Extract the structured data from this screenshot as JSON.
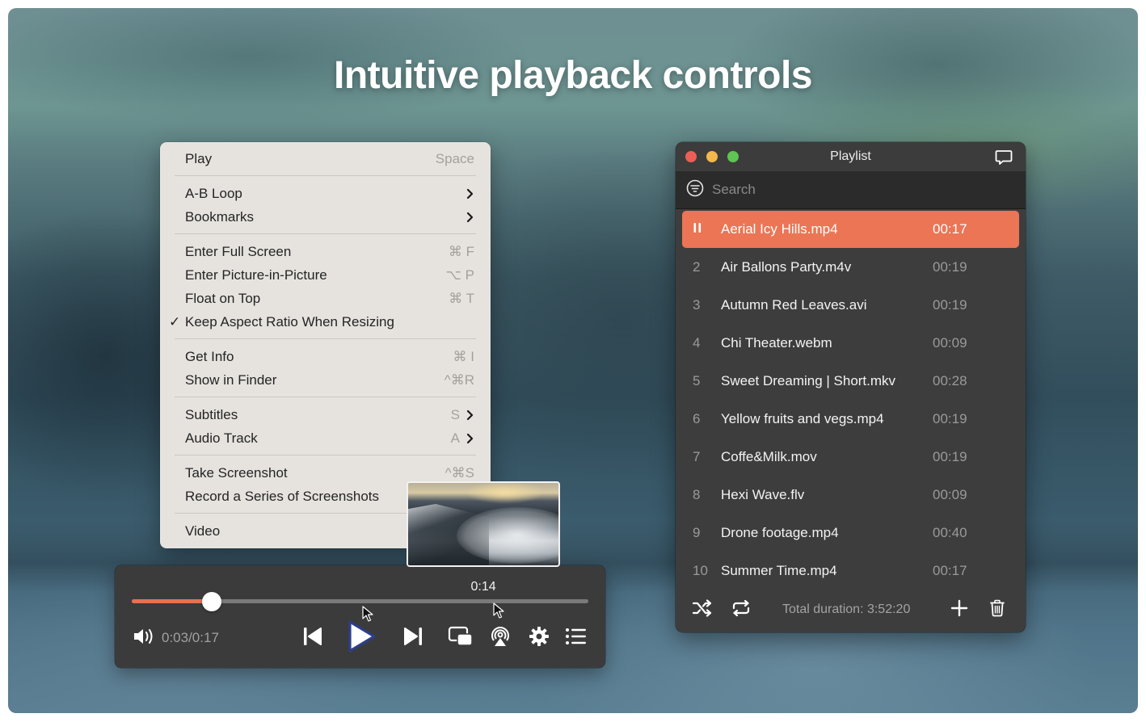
{
  "headline": "Intuitive playback controls",
  "context_menu": {
    "items": [
      {
        "label": "Play",
        "shortcut": "Space"
      },
      {
        "label": "A-B Loop",
        "submenu": true
      },
      {
        "label": "Bookmarks",
        "submenu": true
      },
      {
        "label": "Enter Full Screen",
        "shortcut": "⌘ F"
      },
      {
        "label": "Enter Picture-in-Picture",
        "shortcut": "⌥ P"
      },
      {
        "label": "Float on Top",
        "shortcut": "⌘ T"
      },
      {
        "label": "Keep Aspect Ratio When Resizing",
        "checked": true,
        "check_glyph": "✓"
      },
      {
        "label": "Get Info",
        "shortcut": "⌘ I"
      },
      {
        "label": "Show in Finder",
        "shortcut": "^⌘R"
      },
      {
        "label": "Subtitles",
        "shortcut": "S",
        "submenu": true
      },
      {
        "label": "Audio Track",
        "shortcut": "A",
        "submenu": true
      },
      {
        "label": "Take Screenshot",
        "shortcut": "^⌘S"
      },
      {
        "label": "Record a Series of Screenshots"
      },
      {
        "label": "Video"
      }
    ]
  },
  "player": {
    "hover_time": "0:14",
    "hover_fraction": 0.77,
    "progress_fraction": 0.176,
    "time_readout": "0:03/0:17",
    "accent_color": "#e8704f",
    "icons": {
      "volume": "speaker-volume-icon",
      "previous": "skip-previous-icon",
      "play": "play-icon",
      "next": "skip-next-icon",
      "pip": "picture-in-picture-icon",
      "airplay": "airplay-icon",
      "settings": "gear-icon",
      "playlist": "list-icon"
    }
  },
  "playlist": {
    "title": "Playlist",
    "search_placeholder": "Search",
    "active_color": "#eb7555",
    "items": [
      {
        "index": "⏸",
        "name": "Aerial Icy Hills.mp4",
        "duration": "00:17",
        "playing": true
      },
      {
        "index": "2",
        "name": "Air Ballons Party.m4v",
        "duration": "00:19"
      },
      {
        "index": "3",
        "name": "Autumn Red Leaves.avi",
        "duration": "00:19"
      },
      {
        "index": "4",
        "name": "Chi Theater.webm",
        "duration": "00:09"
      },
      {
        "index": "5",
        "name": "Sweet Dreaming | Short.mkv",
        "duration": "00:28"
      },
      {
        "index": "6",
        "name": "Yellow fruits and vegs.mp4",
        "duration": "00:19"
      },
      {
        "index": "7",
        "name": "Coffe&Milk.mov",
        "duration": "00:19"
      },
      {
        "index": "8",
        "name": "Hexi Wave.flv",
        "duration": "00:09"
      },
      {
        "index": "9",
        "name": "Drone footage.mp4",
        "duration": "00:40"
      },
      {
        "index": "10",
        "name": "Summer Time.mp4",
        "duration": "00:17"
      }
    ],
    "total_duration": "Total duration: 3:52:20"
  }
}
